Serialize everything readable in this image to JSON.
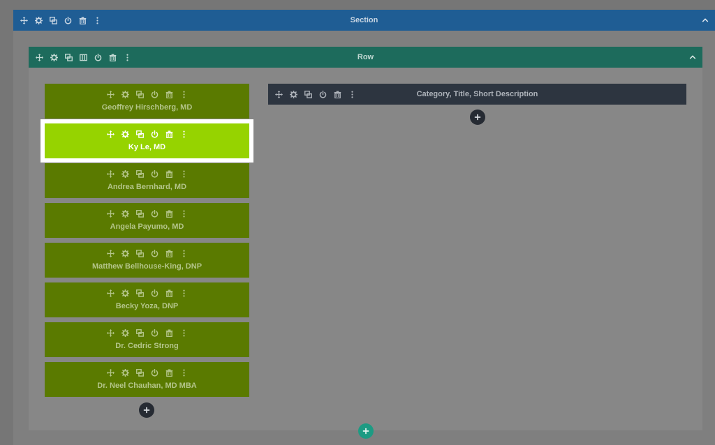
{
  "section": {
    "title": "Section"
  },
  "row": {
    "title": "Row"
  },
  "left_column": {
    "modules": [
      {
        "label": "Geoffrey Hirschberg, MD",
        "active": false
      },
      {
        "label": "Ky Le, MD",
        "active": true
      },
      {
        "label": "Andrea Bernhard, MD",
        "active": false
      },
      {
        "label": "Angela Payumo, MD",
        "active": false
      },
      {
        "label": "Matthew Bellhouse-King, DNP",
        "active": false
      },
      {
        "label": "Becky Yoza, DNP",
        "active": false
      },
      {
        "label": "Dr. Cedric Strong",
        "active": false
      },
      {
        "label": "Dr. Neel Chauhan, MD MBA",
        "active": false
      }
    ]
  },
  "right_column": {
    "modules": [
      {
        "label": "Category, Title, Short Description"
      }
    ]
  },
  "icons": {
    "toolbar": [
      "move-icon",
      "gear-icon",
      "duplicate-icon",
      "power-icon",
      "trash-icon",
      "more-icon"
    ],
    "row_toolbar": [
      "move-icon",
      "gear-icon",
      "duplicate-icon",
      "columns-icon",
      "power-icon",
      "trash-icon",
      "more-icon"
    ],
    "collapse": "chevron-up-icon",
    "add": "plus-icon"
  },
  "colors": {
    "section_bar": "#1f5d94",
    "row_bar": "#1d6b5c",
    "module": "#5a7a00",
    "module_active": "#96d300",
    "right_module": "#2d3540",
    "add_dark": "#262b33",
    "add_teal": "#1d9b83"
  }
}
